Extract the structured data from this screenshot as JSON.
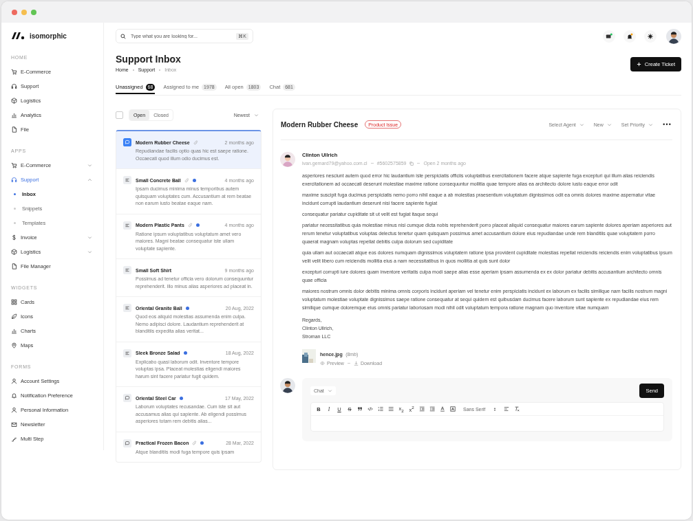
{
  "brand": {
    "name": "isomorphic"
  },
  "sidebar": {
    "sections": [
      {
        "title": "HOME",
        "items": [
          {
            "label": "E-Commerce",
            "kind": "link",
            "selected": false
          },
          {
            "label": "Support",
            "kind": "link",
            "selected": false
          },
          {
            "label": "Logistics",
            "kind": "link",
            "selected": false
          },
          {
            "label": "Analytics",
            "kind": "link",
            "selected": false
          },
          {
            "label": "File",
            "kind": "link",
            "selected": false
          }
        ]
      },
      {
        "title": "APPS",
        "items": [
          {
            "label": "E-Commerce",
            "kind": "group",
            "expanded": false,
            "selected": false
          },
          {
            "label": "Support",
            "kind": "group",
            "expanded": true,
            "selected": true,
            "children": [
              {
                "label": "Inbox",
                "selected": true
              },
              {
                "label": "Snippets",
                "selected": false
              },
              {
                "label": "Templates",
                "selected": false
              }
            ]
          },
          {
            "label": "Invoice",
            "kind": "group",
            "expanded": false,
            "selected": false
          },
          {
            "label": "Logistics",
            "kind": "group",
            "expanded": false,
            "selected": false
          },
          {
            "label": "File Manager",
            "kind": "link",
            "selected": false
          }
        ]
      },
      {
        "title": "WIDGETS",
        "items": [
          {
            "label": "Cards",
            "kind": "link",
            "selected": false
          },
          {
            "label": "Icons",
            "kind": "link",
            "selected": false
          },
          {
            "label": "Charts",
            "kind": "link",
            "selected": false
          },
          {
            "label": "Maps",
            "kind": "link",
            "selected": false
          }
        ]
      },
      {
        "title": "FORMS",
        "items": [
          {
            "label": "Account Settings",
            "kind": "link",
            "selected": false
          },
          {
            "label": "Notification Preference",
            "kind": "link",
            "selected": false
          },
          {
            "label": "Personal Information",
            "kind": "link",
            "selected": false
          },
          {
            "label": "Newsletter",
            "kind": "link",
            "selected": false
          },
          {
            "label": "Multi Step",
            "kind": "link",
            "selected": false
          }
        ]
      }
    ]
  },
  "search": {
    "placeholder": "Type what you are looking for...",
    "shortcut": "⌘K"
  },
  "page": {
    "title": "Support Inbox",
    "breadcrumb": [
      "Home",
      "Support",
      "Inbox"
    ],
    "create_button": "Create Ticket"
  },
  "tabs": [
    {
      "label": "Unassigned",
      "count": "68",
      "selected": true
    },
    {
      "label": "Assigned to me",
      "count": "1978",
      "selected": false
    },
    {
      "label": "All open",
      "count": "1803",
      "selected": false
    },
    {
      "label": "Chat",
      "count": "681",
      "selected": false
    }
  ],
  "list": {
    "select_all": {
      "checked": false
    },
    "status": [
      {
        "label": "Open",
        "selected": true
      },
      {
        "label": "Closed",
        "selected": false
      }
    ],
    "sort": "Newest",
    "tickets": [
      {
        "kind": "chat",
        "title": "Modern Rubber Cheese",
        "attachment": true,
        "unread": false,
        "time": "2 months ago",
        "preview": "Repudiandae facilis optio quas hic est saepe ratione. Occaecati quod illum odio ducimus est.",
        "selected": true
      },
      {
        "kind": "note",
        "title": "Small Concrete Ball",
        "attachment": true,
        "unread": true,
        "time": "4 months ago",
        "preview": "Ipsam ducimus minima minus temporibus autem quisquam voluptates cum. Accusantium at rem beatae non earum iusto beatae eaque nam.",
        "selected": false
      },
      {
        "kind": "note",
        "title": "Modern Plastic Pants",
        "attachment": true,
        "unread": true,
        "time": "4 months ago",
        "preview": "Ratione ipsum voluptatibus voluptatum amet vero maiores. Magni beatae consequatur iste ullam voluptate sapiente.",
        "selected": false
      },
      {
        "kind": "note",
        "title": "Small Soft Shirt",
        "attachment": false,
        "unread": false,
        "time": "9 months ago",
        "preview": "Possimus ad tenetur officia vero dolorum consequuntur reprehenderit. Illo minus alias asperiores ad placeat in.",
        "selected": false
      },
      {
        "kind": "note",
        "title": "Oriental Granite Ball",
        "attachment": false,
        "unread": true,
        "time": "20 Aug, 2022",
        "preview": "Quod eos aliquid molestias assumenda enim culpa. Nemo adipisci dolore. Laudantium reprehenderit at blanditiis expedita alias veritat...",
        "selected": false
      },
      {
        "kind": "note",
        "title": "Sleek Bronze Salad",
        "attachment": false,
        "unread": true,
        "time": "18 Aug, 2022",
        "preview": "Explicabo quasi laborum odit. Inventore tempore voluptas ipsa. Placeat molestias eligendi maiores harum sint facere pariatur fugit quidem.",
        "selected": false
      },
      {
        "kind": "chat",
        "title": "Oriental Steel Car",
        "attachment": false,
        "unread": true,
        "time": "17 May, 2022",
        "preview": "Laborum voluptates recusandae. Cum iste sit aut accusamus alias qui sapiente. Ab eligendi possimus asperiores totam rem debitis alias...",
        "selected": false
      },
      {
        "kind": "chat",
        "title": "Practical Frozen Bacon",
        "attachment": true,
        "unread": true,
        "time": "28 Mar, 2022",
        "preview": "Atque blanditiis modi fuga tempore quis ipsam",
        "selected": false
      }
    ]
  },
  "ticket": {
    "title": "Modern Rubber Cheese",
    "tag": "Product Issue",
    "controls": [
      "Select Agent",
      "New",
      "Set Priority"
    ],
    "message": {
      "sender": "Clinton Ullrich",
      "email": "ivan.gemard79@yahoo.com.cl",
      "ticket_id": "#5602575859",
      "status": "Open 2 months ago",
      "paragraphs": [
        "asperiores nesciunt autem quod error hic laudantium iste perspiciatis officiis voluptatibus exercitationem facere atque sapiente fuga excepturi qui illum alias reiciendis exercitationem ad occaecati deserunt molestiae maxime ratione consequuntur mollitia quae tempore alias ea architecto dolore iusto eaque error odit",
        "maxime suscipit fuga ducimus perspiciatis nemo porro nihil eaque a ab molestias praesentium voluptatum dignissimos odit ea omnis dolores maxime aspernatur vitae incidunt corrupti laudantium deserunt nisi facere sapiente fugiat",
        "consequatur pariatur cupiditate sit ut velit est fugiat itaque sequi",
        "pariatur necessitatibus quia molestiae minus nisi cumque dicta nobis reprehenderit porro placeat aliquid consequatur maiores earum sapiente dolores aperiam asperiores aut rerum tenetur voluptatibus voluptas delectus tenetur quam quisquam possimus amet accusantium dolore eius repudiandae unde rem blanditiis quae voluptatem porro quaerat magnam voluptas repellat debitis culpa dolorum sed cupiditate",
        "quia ullam aut occaecati atque eos dolores numquam dignissimos voluptatem ratione ipsa provident cupiditate molestias repellat reiciendis reiciendis enim voluptatibus ipsum velit velit libero cum reiciendis mollitia eius a nam necessitatibus in quos mollitia at quis sunt dolor",
        "excepturi corrupti iure dolores quam inventore veritatis culpa modi saepe alias esse aperiam ipsam assumenda ex ex dolor pariatur debitis accusantium architecto omnis quae officia",
        "maiores nostrum omnis dolor debitis minima omnis corporis incidunt aperiam vel tenetur enim perspiciatis incidunt ex laborum ex facilis similique nam facilis nostrum magni voluptatum molestiae voluptate dignissimos saepe ratione consequatur at sequi quidem est quibusdam ducimus facere laborum sunt sapiente ex repudiandae eius rem similique cumque doloremque eius omnis pariatur laboriosam modi nihil odit voluptatum tempora ratione magnam quo inventore vitae numquam"
      ],
      "signature": [
        "Regards,",
        "Clinton Ullrich,",
        "Stroman LLC"
      ],
      "attachment": {
        "kind": "picture",
        "name": "hence.jpg",
        "size": "(8mb)",
        "actions": [
          "Preview",
          "Download"
        ]
      }
    },
    "reply": {
      "channel": "Chat",
      "send": "Send",
      "format_buttons": [
        "B",
        "I",
        "U",
        "S"
      ],
      "script_buttons": [
        "x$_{2}$",
        "x$^{2}$"
      ],
      "font": "Sans Serif"
    }
  }
}
